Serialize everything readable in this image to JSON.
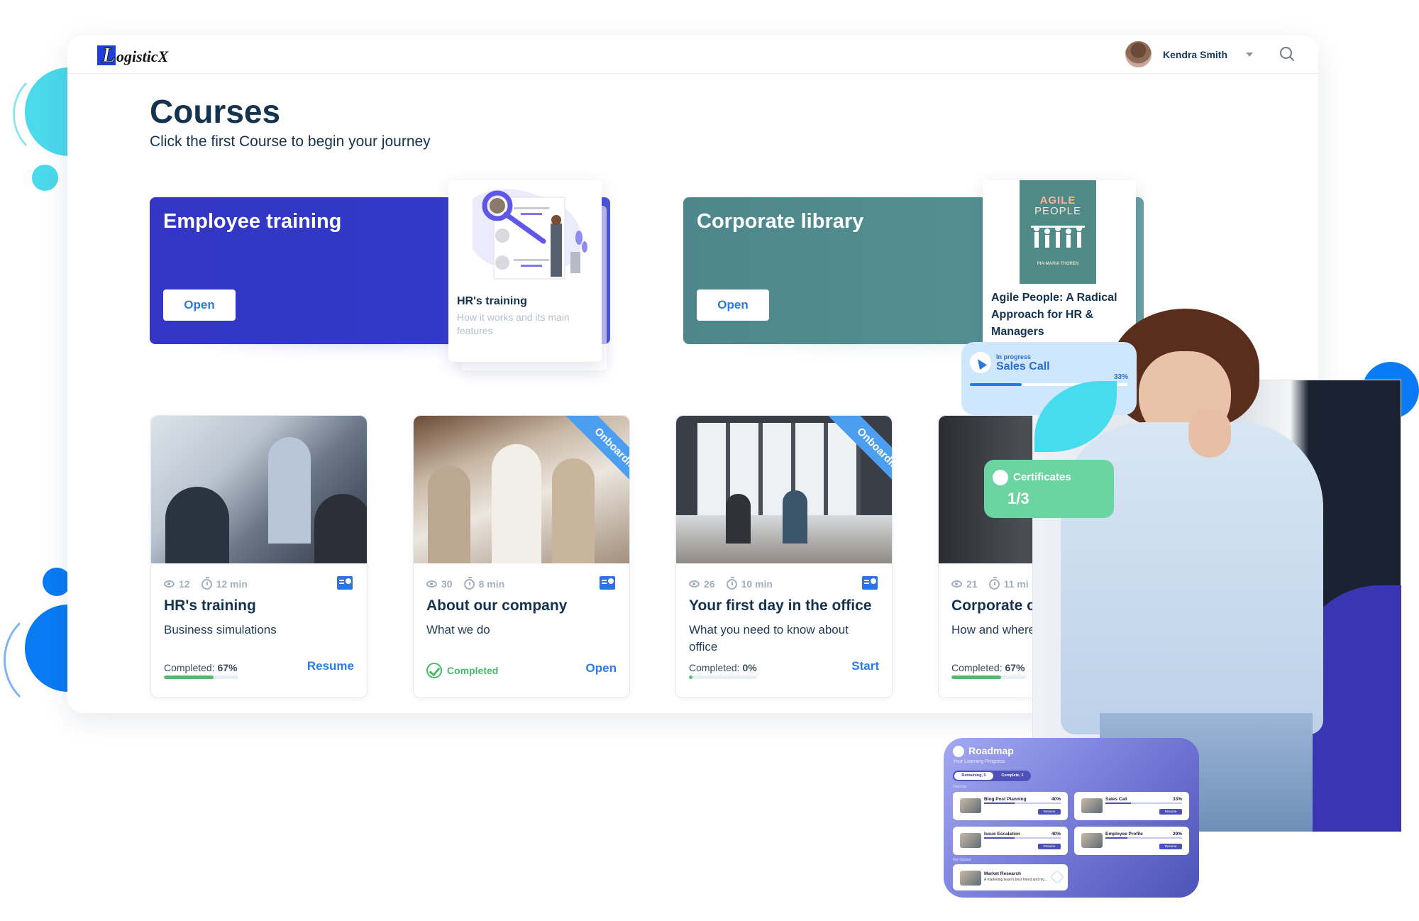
{
  "app": {
    "logo_letter": "L",
    "logo_text": "ogisticX"
  },
  "header": {
    "user_name": "Kendra Smith"
  },
  "page": {
    "title": "Courses",
    "subtitle": "Click the first Course to begin your journey"
  },
  "banners": [
    {
      "title": "Employee training",
      "button": "Open",
      "color": "#323cc6",
      "popup": {
        "title": "HR's training",
        "subtitle": "How it works and its main features"
      }
    },
    {
      "title": "Corporate library",
      "button": "Open",
      "color": "#4f8a8f",
      "popup": {
        "book_title_1": "AGILE",
        "book_title_2": "PEOPLE",
        "book_author": "PIA-MARIA THOREN",
        "title": "Agile People: A Radical Approach for HR & Managers"
      }
    }
  ],
  "courses": [
    {
      "views": "12",
      "duration": "12 min",
      "title": "HR's training",
      "subtitle": "Business simulations",
      "progress_label": "Completed:",
      "progress": 67,
      "progress_text": "67%",
      "action": "Resume",
      "ribbon": null
    },
    {
      "views": "30",
      "duration": "8 min",
      "title": "About our company",
      "subtitle": "What we do",
      "status": "Completed",
      "action": "Open",
      "ribbon": "Onboarding"
    },
    {
      "views": "26",
      "duration": "10 min",
      "title": "Your first day in the office",
      "subtitle": "What you need to know about office",
      "progress_label": "Completed:",
      "progress": 0,
      "progress_text": "0%",
      "action": "Start",
      "ribbon": "Onboarding"
    },
    {
      "views": "21",
      "duration": "11 mi",
      "title": "Corporate c",
      "subtitle": "How and where",
      "progress_label": "Completed:",
      "progress": 67,
      "progress_text": "67%",
      "ribbon": null
    }
  ],
  "overlays": {
    "sales_chip": {
      "status": "In progress",
      "title": "Sales Call",
      "percent": "33%",
      "progress": 33
    },
    "certificates": {
      "label": "Certificates",
      "value": "1/3"
    },
    "roadmap": {
      "title": "Roadmap",
      "subtitle": "Your Learning Progress",
      "tab_remaining": "Remaining, 5",
      "tab_complete": "Complete, 1",
      "section_ongoing": "Ongoing",
      "section_not_started": "Not Started",
      "items": [
        {
          "title": "Blog Post Planning",
          "percent": "40%",
          "progress": 40,
          "button": "Resume"
        },
        {
          "title": "Sales Call",
          "percent": "33%",
          "progress": 33,
          "button": "Resume"
        },
        {
          "title": "Issue Escalation",
          "percent": "40%",
          "progress": 40,
          "button": "Resume"
        },
        {
          "title": "Employee Profile",
          "percent": "29%",
          "progress": 29,
          "button": "Resume"
        }
      ],
      "not_started": {
        "title": "Market Research",
        "subtitle": "A marketing team's best friend and mu..."
      }
    }
  }
}
